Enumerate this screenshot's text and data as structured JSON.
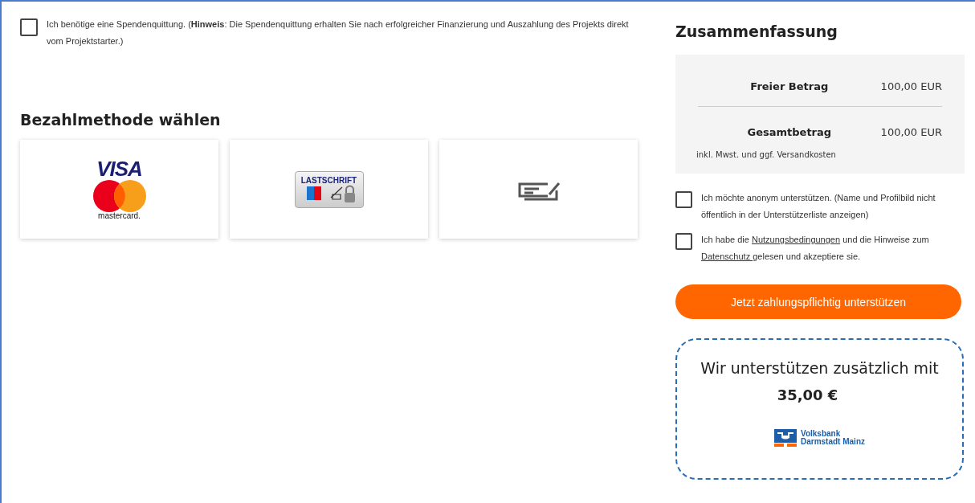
{
  "receipt": {
    "checked": false,
    "text": "Ich benötige eine Spendenquittung. (**Hinweis**: Die Spendenquittung erhalten Sie nach erfolgreicher Finanzierung und Auszahlung des Projekts direkt vom Projektstarter.)"
  },
  "payment": {
    "heading": "Bezahlmethode wählen",
    "methods": [
      {
        "kind": "card",
        "selected": false,
        "texts": [
          "VISA",
          "mastercard."
        ]
      },
      {
        "kind": "debit",
        "selected": false,
        "texts": [
          "LASTSCHRIFT"
        ]
      },
      {
        "kind": "invoice",
        "selected": false
      }
    ]
  },
  "summary": {
    "title": "Zusammenfassung",
    "rows": [
      {
        "label": "Freier Betrag",
        "value": "100,00 EUR"
      },
      {
        "label": "Gesamtbetrag",
        "value": "100,00 EUR"
      }
    ],
    "note": "inkl. Mwst. und ggf. Versandkosten"
  },
  "consents": [
    {
      "checked": false,
      "parts": [
        {
          "kind": "text",
          "text": "Ich möchte anonym unterstützen. (Name und Profilbild nicht öffentlich in der Unterstützerliste anzeigen)"
        }
      ]
    },
    {
      "checked": false,
      "parts": [
        {
          "kind": "text",
          "text": "Ich habe die "
        },
        {
          "kind": "link",
          "text": "Nutzungsbedingungen"
        },
        {
          "kind": "text",
          "text": " und die Hinweise zum "
        },
        {
          "kind": "link",
          "text": "Datenschutz "
        },
        {
          "kind": "text",
          "text": "gelesen und akzeptiere sie."
        }
      ]
    }
  ],
  "submit": {
    "label": "Jetzt zahlungspflichtig unterstützen"
  },
  "sponsor": {
    "text": "Wir unterstützen zusätzlich mit",
    "amount": "35,00 €",
    "logo": [
      "Volksbank",
      "Darmstadt Mainz"
    ]
  }
}
